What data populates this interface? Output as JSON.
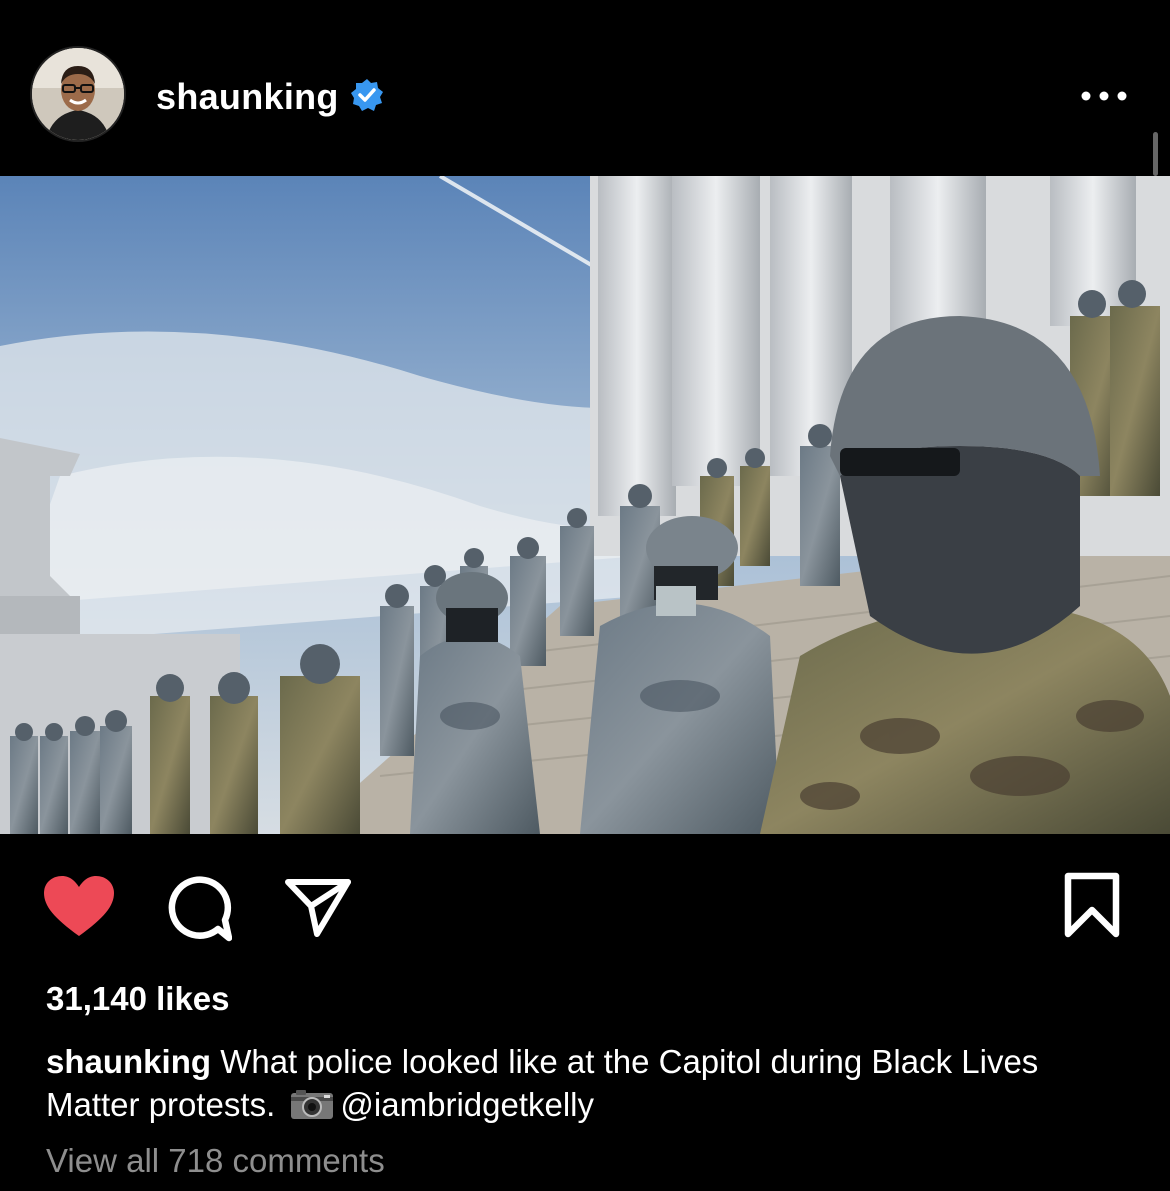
{
  "post": {
    "username": "shaunking",
    "verified": true,
    "likes_text": "31,140 likes",
    "caption_username": "shaunking",
    "caption_text": " What police looked like at the Capitol during Black Lives Matter protests. ",
    "caption_mention": "@iambridgetkelly",
    "view_comments_text": "View all 718 comments",
    "liked": true
  },
  "icons": {
    "more": "more-horizontal-icon",
    "like": "heart-icon",
    "comment": "comment-icon",
    "share": "send-icon",
    "save": "bookmark-icon",
    "camera": "camera-emoji"
  },
  "colors": {
    "background": "#000000",
    "text": "#ffffff",
    "muted": "#8e8e8e",
    "like": "#ed4956",
    "verified": "#3897f0"
  }
}
